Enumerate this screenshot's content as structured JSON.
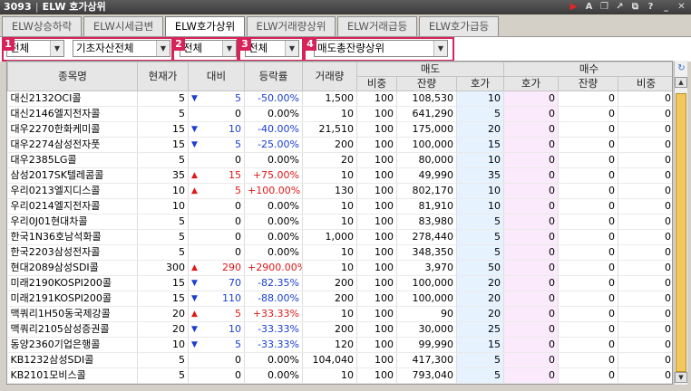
{
  "window": {
    "code": "3093",
    "title": "ELW 호가상위",
    "icons": [
      "arrow-icon",
      "font-icon",
      "copy-icon",
      "link-icon",
      "popout-icon",
      "help-icon",
      "minimize-icon",
      "close-icon"
    ]
  },
  "tabs": [
    {
      "label": "ELW상승하락",
      "active": false
    },
    {
      "label": "ELW시세급변",
      "active": false
    },
    {
      "label": "ELW호가상위",
      "active": true
    },
    {
      "label": "ELW거래량상위",
      "active": false
    },
    {
      "label": "ELW거래급등",
      "active": false
    },
    {
      "label": "ELW호가급등",
      "active": false
    }
  ],
  "filters": {
    "market": "전체",
    "underlying": "기초자산전체",
    "type": "전체",
    "range": "전체",
    "sort": "매도총잔량상위",
    "badges": [
      "1",
      "2",
      "3",
      "4"
    ]
  },
  "headers": {
    "name": "종목명",
    "price": "현재가",
    "change": "대비",
    "rate": "등락률",
    "volume": "거래량",
    "sell_group": "매도",
    "buy_group": "매수",
    "sell_ratio": "비중",
    "sell_remain": "잔량",
    "sell_quote": "호가",
    "buy_quote": "호가",
    "buy_remain": "잔량",
    "buy_ratio": "비중"
  },
  "rows": [
    {
      "name": "대신2132OCI콜",
      "price": "5",
      "dir": "down",
      "change": "5",
      "rate": "-50.00%",
      "volume": "1,500",
      "s_ratio": "100",
      "s_remain": "108,530",
      "s_quote": "10",
      "b_quote": "0",
      "b_remain": "0",
      "b_ratio": "0"
    },
    {
      "name": "대신2146엘지전자콜",
      "price": "5",
      "dir": "none",
      "change": "0",
      "rate": "0.00%",
      "volume": "10",
      "s_ratio": "100",
      "s_remain": "641,290",
      "s_quote": "5",
      "b_quote": "0",
      "b_remain": "0",
      "b_ratio": "0"
    },
    {
      "name": "대우2270한화케미콜",
      "price": "15",
      "dir": "down",
      "change": "10",
      "rate": "-40.00%",
      "volume": "21,510",
      "s_ratio": "100",
      "s_remain": "175,000",
      "s_quote": "20",
      "b_quote": "0",
      "b_remain": "0",
      "b_ratio": "0"
    },
    {
      "name": "대우2274삼성전자풋",
      "price": "15",
      "dir": "down",
      "change": "5",
      "rate": "-25.00%",
      "volume": "200",
      "s_ratio": "100",
      "s_remain": "100,000",
      "s_quote": "15",
      "b_quote": "0",
      "b_remain": "0",
      "b_ratio": "0"
    },
    {
      "name": "대우2385LG콜",
      "price": "5",
      "dir": "none",
      "change": "0",
      "rate": "0.00%",
      "volume": "20",
      "s_ratio": "100",
      "s_remain": "80,000",
      "s_quote": "10",
      "b_quote": "0",
      "b_remain": "0",
      "b_ratio": "0"
    },
    {
      "name": "삼성2017SK텔레콤콜",
      "price": "35",
      "dir": "up",
      "change": "15",
      "rate": "+75.00%",
      "volume": "10",
      "s_ratio": "100",
      "s_remain": "49,990",
      "s_quote": "35",
      "b_quote": "0",
      "b_remain": "0",
      "b_ratio": "0"
    },
    {
      "name": "우리0213엘지디스콜",
      "price": "10",
      "dir": "up",
      "change": "5",
      "rate": "+100.00%",
      "volume": "130",
      "s_ratio": "100",
      "s_remain": "802,170",
      "s_quote": "10",
      "b_quote": "0",
      "b_remain": "0",
      "b_ratio": "0"
    },
    {
      "name": "우리0214엘지전자콜",
      "price": "10",
      "dir": "none",
      "change": "0",
      "rate": "0.00%",
      "volume": "10",
      "s_ratio": "100",
      "s_remain": "81,910",
      "s_quote": "10",
      "b_quote": "0",
      "b_remain": "0",
      "b_ratio": "0"
    },
    {
      "name": "우리0J01현대차콜",
      "price": "5",
      "dir": "none",
      "change": "0",
      "rate": "0.00%",
      "volume": "10",
      "s_ratio": "100",
      "s_remain": "83,980",
      "s_quote": "5",
      "b_quote": "0",
      "b_remain": "0",
      "b_ratio": "0"
    },
    {
      "name": "한국1N36호남석화콜",
      "price": "5",
      "dir": "none",
      "change": "0",
      "rate": "0.00%",
      "volume": "1,000",
      "s_ratio": "100",
      "s_remain": "278,440",
      "s_quote": "5",
      "b_quote": "0",
      "b_remain": "0",
      "b_ratio": "0"
    },
    {
      "name": "한국2203삼성전자콜",
      "price": "5",
      "dir": "none",
      "change": "0",
      "rate": "0.00%",
      "volume": "10",
      "s_ratio": "100",
      "s_remain": "348,350",
      "s_quote": "5",
      "b_quote": "0",
      "b_remain": "0",
      "b_ratio": "0"
    },
    {
      "name": "현대2089삼성SDI콜",
      "price": "300",
      "dir": "up",
      "change": "290",
      "rate": "+2900.00%",
      "volume": "10",
      "s_ratio": "100",
      "s_remain": "3,970",
      "s_quote": "50",
      "b_quote": "0",
      "b_remain": "0",
      "b_ratio": "0"
    },
    {
      "name": "미래2190KOSPI200콜",
      "price": "15",
      "dir": "down",
      "change": "70",
      "rate": "-82.35%",
      "volume": "200",
      "s_ratio": "100",
      "s_remain": "100,000",
      "s_quote": "20",
      "b_quote": "0",
      "b_remain": "0",
      "b_ratio": "0"
    },
    {
      "name": "미래2191KOSPI200콜",
      "price": "15",
      "dir": "down",
      "change": "110",
      "rate": "-88.00%",
      "volume": "200",
      "s_ratio": "100",
      "s_remain": "100,000",
      "s_quote": "20",
      "b_quote": "0",
      "b_remain": "0",
      "b_ratio": "0"
    },
    {
      "name": "맥쿼리1H50동국제강콜",
      "price": "20",
      "dir": "up",
      "change": "5",
      "rate": "+33.33%",
      "volume": "10",
      "s_ratio": "100",
      "s_remain": "90",
      "s_quote": "20",
      "b_quote": "0",
      "b_remain": "0",
      "b_ratio": "0"
    },
    {
      "name": "맥쿼리2105삼성증권콜",
      "price": "20",
      "dir": "down",
      "change": "10",
      "rate": "-33.33%",
      "volume": "200",
      "s_ratio": "100",
      "s_remain": "30,000",
      "s_quote": "25",
      "b_quote": "0",
      "b_remain": "0",
      "b_ratio": "0"
    },
    {
      "name": "동양2360기업은행콜",
      "price": "10",
      "dir": "down",
      "change": "5",
      "rate": "-33.33%",
      "volume": "120",
      "s_ratio": "100",
      "s_remain": "99,990",
      "s_quote": "15",
      "b_quote": "0",
      "b_remain": "0",
      "b_ratio": "0"
    },
    {
      "name": "KB1232삼성SDI콜",
      "price": "5",
      "dir": "none",
      "change": "0",
      "rate": "0.00%",
      "volume": "104,040",
      "s_ratio": "100",
      "s_remain": "417,300",
      "s_quote": "5",
      "b_quote": "0",
      "b_remain": "0",
      "b_ratio": "0"
    },
    {
      "name": "KB2101모비스콜",
      "price": "5",
      "dir": "none",
      "change": "0",
      "rate": "0.00%",
      "volume": "10",
      "s_ratio": "100",
      "s_remain": "793,040",
      "s_quote": "5",
      "b_quote": "0",
      "b_remain": "0",
      "b_ratio": "0"
    }
  ],
  "colors": {
    "up": "#e01818",
    "down": "#1a3fd0",
    "sell_bg": "#e6f3ff",
    "buy_bg": "#fbeafb",
    "highlight_box": "#d8225a",
    "scroll_thumb": "#f2c75c"
  }
}
